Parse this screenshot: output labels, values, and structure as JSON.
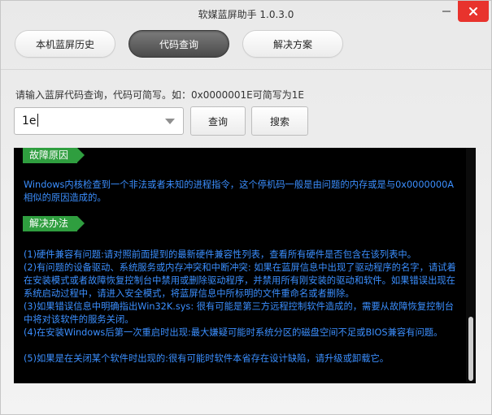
{
  "window": {
    "title": "软媒蓝屏助手 1.0.3.0"
  },
  "tabs": [
    {
      "label": "本机蓝屏历史",
      "active": false
    },
    {
      "label": "代码查询",
      "active": true
    },
    {
      "label": "解决方案",
      "active": false
    }
  ],
  "query": {
    "hint": "请输入蓝屏代码查询，代码可简写。如：0x0000001E可简写为1E",
    "input_value": "1e",
    "query_button": "查询",
    "search_button": "搜索"
  },
  "result": {
    "cause_tag": "故障原因",
    "cause_text": "Windows内核检查到一个非法或者未知的进程指令，这个停机码一般是由问题的内存或是与0x0000000A相似的原因造成的。",
    "solution_tag": "解决办法",
    "solutions": [
      "(1)硬件兼容有问题:请对照前面提到的最新硬件兼容性列表，查看所有硬件是否包含在该列表中。",
      "(2)有问题的设备驱动、系统服务或内存冲突和中断冲突: 如果在蓝屏信息中出现了驱动程序的名字，请试着在安装模式或者故障恢复控制台中禁用或删除驱动程序，并禁用所有刚安装的驱动和软件。如果错误出现在系统启动过程中，请进入安全模式，将蓝屏信息中所标明的文件重命名或者删除。",
      "(3)如果错误信息中明确指出Win32K.sys: 很有可能是第三方远程控制软件造成的，需要从故障恢复控制台中将对该软件的服务关闭。",
      "(4)在安装Windows后第一次重启时出现:最大嫌疑可能时系统分区的磁盘空间不足或BIOS兼容有问题。",
      "(5)如果是在关闭某个软件时出现的:很有可能时软件本省存在设计缺陷，请升级或卸载它。"
    ]
  },
  "colors": {
    "accent_green": "#2f9e3f",
    "result_text": "#3b8fff",
    "close_red": "#e8332d"
  }
}
